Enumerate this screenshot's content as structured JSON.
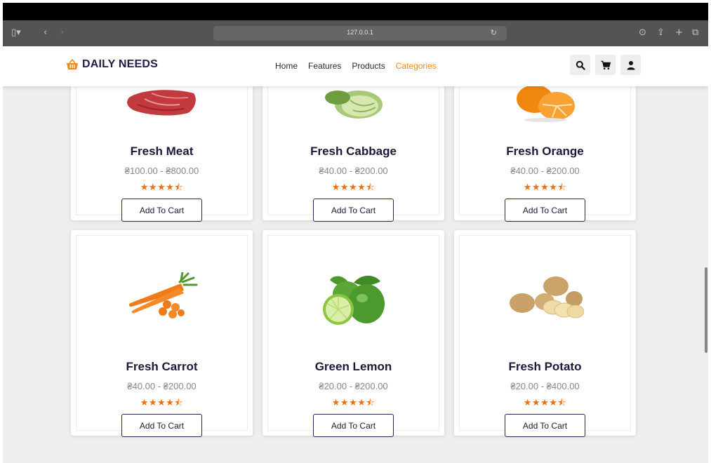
{
  "browser": {
    "url": "127.0.0.1"
  },
  "nav": {
    "brand": "DAILY NEEDS",
    "links": [
      "Home",
      "Features",
      "Products",
      "Categories"
    ],
    "active_link": "Categories",
    "accent_color": "#f08a1c"
  },
  "products": [
    {
      "name": "Fresh Meat",
      "price": "₴100.00 - ₴800.00",
      "rating": 4.5,
      "stars": "★★★★⯪",
      "button": "Add To Cart"
    },
    {
      "name": "Fresh Cabbage",
      "price": "₴40.00 - ₴200.00",
      "rating": 4.5,
      "stars": "★★★★⯪",
      "button": "Add To Cart"
    },
    {
      "name": "Fresh Orange",
      "price": "₴40.00 - ₴200.00",
      "rating": 4.5,
      "stars": "★★★★⯪",
      "button": "Add To Cart"
    },
    {
      "name": "Fresh Carrot",
      "price": "₴40.00 - ₴200.00",
      "rating": 4.5,
      "stars": "★★★★⯪",
      "button": "Add To Cart"
    },
    {
      "name": "Green Lemon",
      "price": "₴20.00 - ₴200.00",
      "rating": 4.5,
      "stars": "★★★★⯪",
      "button": "Add To Cart"
    },
    {
      "name": "Fresh Potato",
      "price": "₴20.00 - ₴400.00",
      "rating": 4.5,
      "stars": "★★★★⯪",
      "button": "Add To Cart"
    }
  ],
  "colors": {
    "star": "#ee6f12",
    "brand_text": "#1e1e48"
  }
}
